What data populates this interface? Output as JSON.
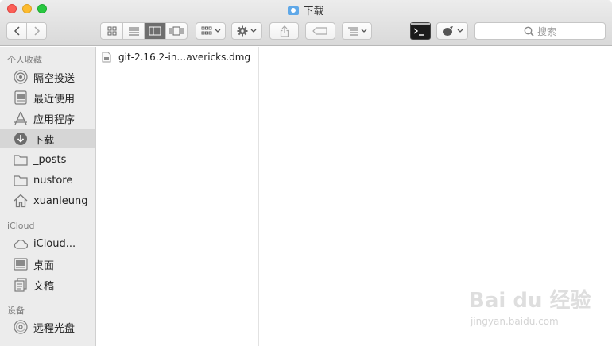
{
  "window": {
    "title": "下载"
  },
  "toolbar": {
    "search_placeholder": "搜索"
  },
  "sidebar": {
    "sections": [
      {
        "label": "个人收藏"
      },
      {
        "label": "iCloud"
      },
      {
        "label": "设备"
      }
    ],
    "items": [
      {
        "label": "隔空投送",
        "icon": "airdrop-icon",
        "selected": false
      },
      {
        "label": "最近使用",
        "icon": "recents-icon",
        "selected": false
      },
      {
        "label": "应用程序",
        "icon": "applications-icon",
        "selected": false
      },
      {
        "label": "下载",
        "icon": "downloads-icon",
        "selected": true
      },
      {
        "label": "_posts",
        "icon": "folder-icon",
        "selected": false
      },
      {
        "label": "nustore",
        "icon": "folder-icon",
        "selected": false
      },
      {
        "label": "xuanleung",
        "icon": "home-icon",
        "selected": false
      },
      {
        "label": "iCloud...",
        "icon": "cloud-icon",
        "selected": false
      },
      {
        "label": "桌面",
        "icon": "desktop-icon",
        "selected": false
      },
      {
        "label": "文稿",
        "icon": "documents-icon",
        "selected": false
      },
      {
        "label": "远程光盘",
        "icon": "disc-icon",
        "selected": false
      }
    ]
  },
  "files": [
    {
      "name": "git-2.16.2-in…avericks.dmg",
      "icon": "dmg-file-icon"
    }
  ],
  "watermark": {
    "brand": "Bai du 经验",
    "url": "jingyan.baidu.com"
  }
}
